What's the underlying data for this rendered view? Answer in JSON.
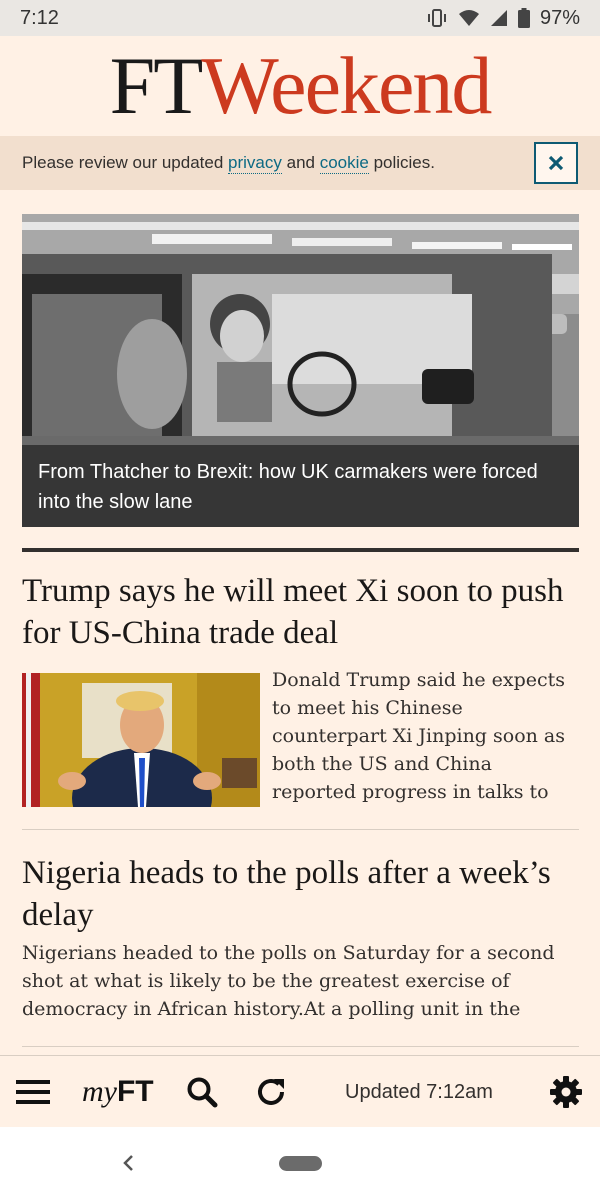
{
  "status_bar": {
    "time": "7:12",
    "battery": "97%",
    "icons": [
      "vibrate-icon",
      "wifi-icon",
      "signal-icon",
      "battery-icon"
    ]
  },
  "masthead": {
    "logo_ft": "FT",
    "logo_weekend": "Weekend",
    "colors": {
      "ft": "#1a1a1a",
      "weekend": "#cc3a1f"
    }
  },
  "cookie_banner": {
    "text_before": "Please review our updated ",
    "privacy_link": "privacy",
    "text_middle": " and ",
    "cookie_link": "cookie",
    "text_after": " policies.",
    "close_icon": "close-icon"
  },
  "hero": {
    "caption": "From Thatcher to Brexit: how UK carmakers were forced into the slow lane"
  },
  "stories": [
    {
      "title": "Trump says he will meet Xi soon to push for US-China trade deal",
      "standfirst": "Donald Trump said he expects to meet his Chinese counterpart Xi Jinping soon as both the US and China reported progress in talks to"
    },
    {
      "title": "Nigeria heads to the polls after a week’s delay",
      "standfirst": "Nigerians headed to the polls on Saturday for a second shot at what is likely to be the greatest exercise of democracy in African history.At a polling unit in the"
    }
  ],
  "toolbar": {
    "menu_icon": "hamburger-menu-icon",
    "myft_italic": "my",
    "myft_bold": "FT",
    "search_icon": "search-icon",
    "refresh_icon": "refresh-icon",
    "updated_text": "Updated 7:12am",
    "settings_icon": "gear-icon"
  },
  "navigation": {
    "back_icon": "chevron-left-icon",
    "home_icon": "home-pill-icon"
  },
  "theme": {
    "page_background": "#fff1e5",
    "banner_background": "#f2dfce",
    "link_color": "#0d6a84"
  }
}
